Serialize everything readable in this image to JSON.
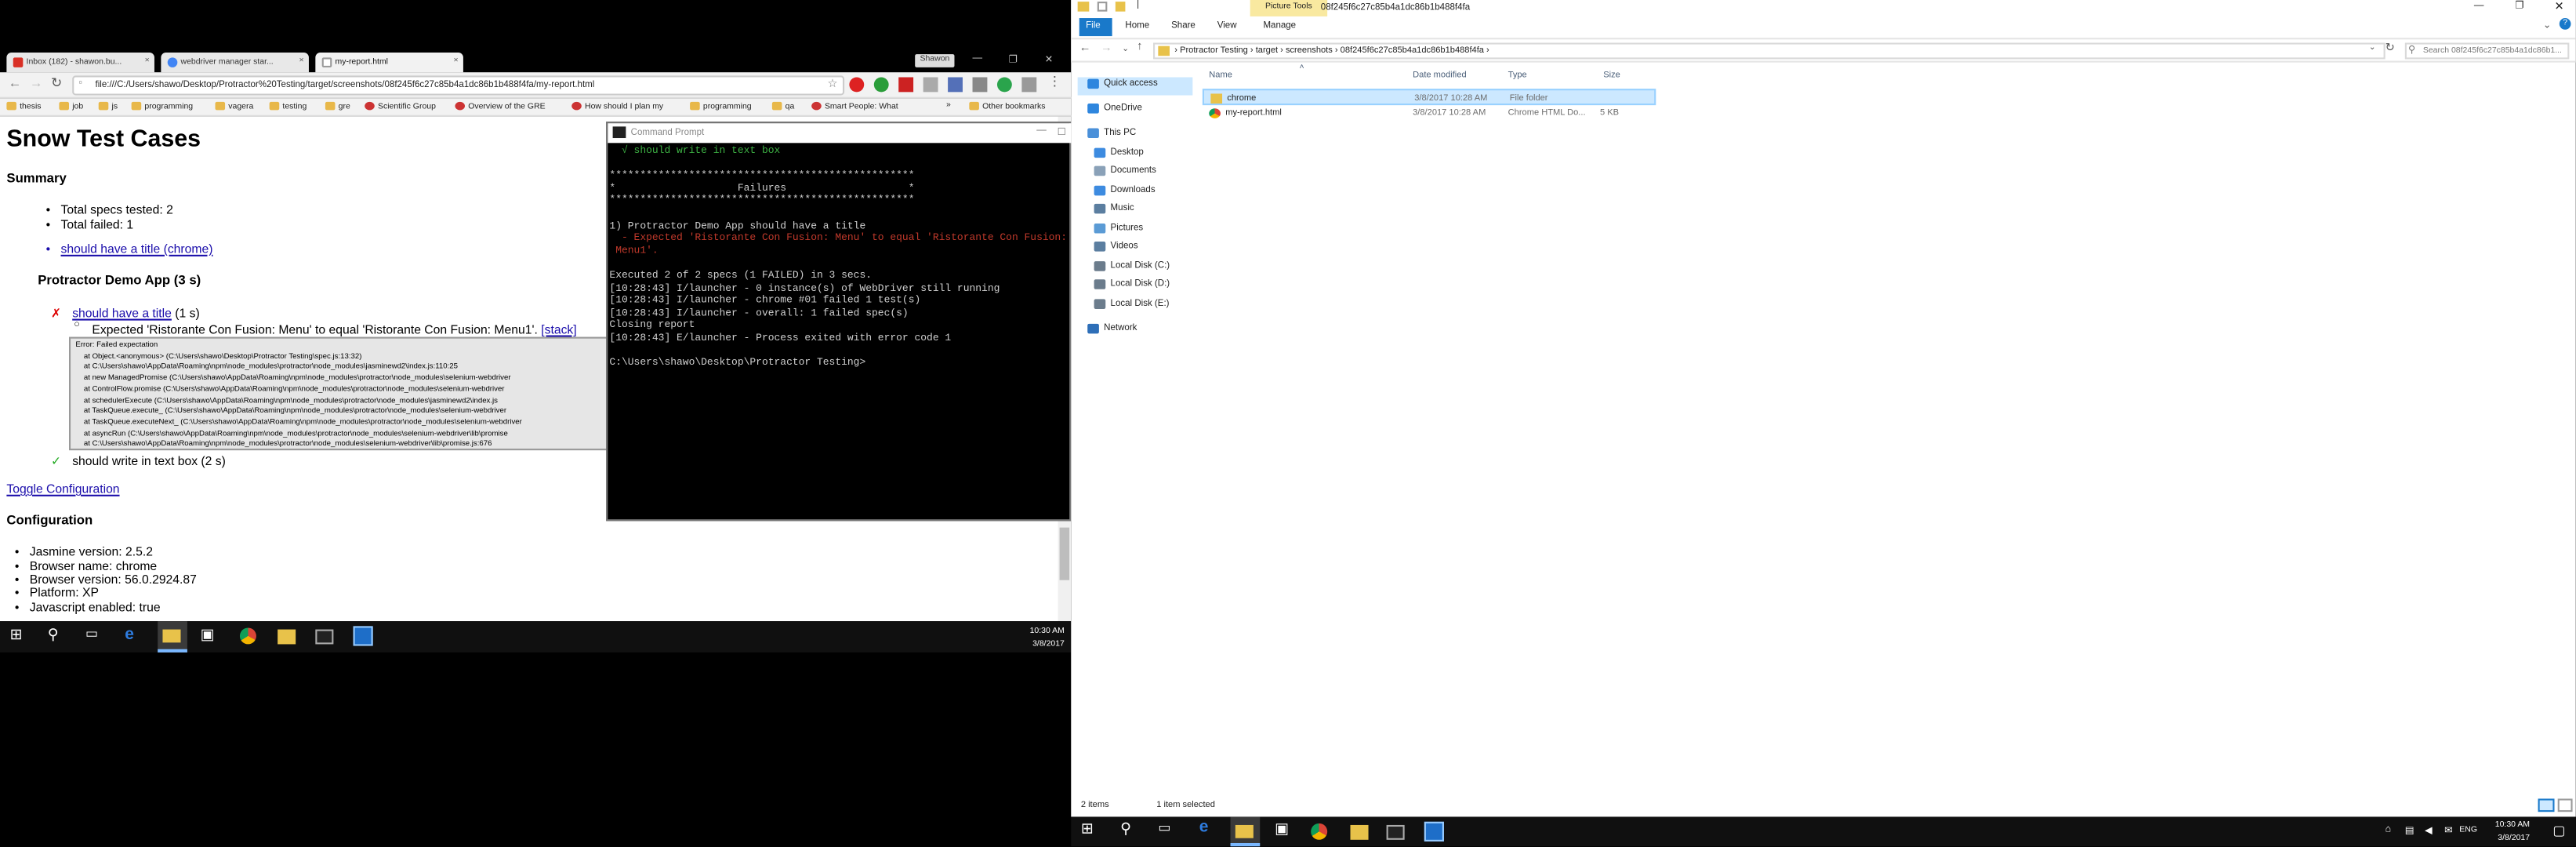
{
  "browser": {
    "tabs": [
      {
        "label": "Inbox (182) - shawon.bu..."
      },
      {
        "label": "webdriver manager star..."
      },
      {
        "label": "my-report.html"
      }
    ],
    "user_label": "Shawon",
    "url": "file:///C:/Users/shawo/Desktop/Protractor%20Testing/target/screenshots/08f245f6c27c85b4a1dc86b1b488f4fa/my-report.html",
    "bookmarks": [
      "thesis",
      "job",
      "js",
      "programming",
      "vagera",
      "testing",
      "gre",
      "Scientific Group",
      "Overview of the GRE",
      "How should I plan my",
      "programming",
      "qa",
      "Smart People: What",
      "Other bookmarks"
    ],
    "overflow": "»"
  },
  "report": {
    "title": "Snow Test Cases",
    "summary_heading": "Summary",
    "total_specs": "Total specs tested: 2",
    "total_failed": "Total failed: 1",
    "failed_link": "should have a title (chrome)",
    "suite": "Protractor Demo App (3 s)",
    "fail_mark": "✗",
    "spec1_link": "should have a title",
    "spec1_time": "(1 s)",
    "expectation": "Expected 'Ristorante Con Fusion: Menu' to equal 'Ristorante Con Fusion: Menu1'.",
    "stack_link": "[stack]",
    "stack": [
      "Error: Failed expectation",
      "at Object.<anonymous> (C:\\Users\\shawo\\Desktop\\Protractor Testing\\spec.js:13:32)",
      "at C:\\Users\\shawo\\AppData\\Roaming\\npm\\node_modules\\protractor\\node_modules\\jasminewd2\\index.js:110:25",
      "at new ManagedPromise (C:\\Users\\shawo\\AppData\\Roaming\\npm\\node_modules\\protractor\\node_modules\\selenium-webdriver",
      "at ControlFlow.promise (C:\\Users\\shawo\\AppData\\Roaming\\npm\\node_modules\\protractor\\node_modules\\selenium-webdriver",
      "at schedulerExecute (C:\\Users\\shawo\\AppData\\Roaming\\npm\\node_modules\\protractor\\node_modules\\jasminewd2\\index.js",
      "at TaskQueue.execute_ (C:\\Users\\shawo\\AppData\\Roaming\\npm\\node_modules\\protractor\\node_modules\\selenium-webdriver",
      "at TaskQueue.executeNext_ (C:\\Users\\shawo\\AppData\\Roaming\\npm\\node_modules\\protractor\\node_modules\\selenium-webdriver",
      "at asyncRun (C:\\Users\\shawo\\AppData\\Roaming\\npm\\node_modules\\protractor\\node_modules\\selenium-webdriver\\lib\\promise",
      "at C:\\Users\\shawo\\AppData\\Roaming\\npm\\node_modules\\protractor\\node_modules\\selenium-webdriver\\lib\\promise.js:676"
    ],
    "pass_mark": "✓",
    "spec2": "should write in text box (2 s)",
    "toggle": "Toggle Configuration",
    "config_heading": "Configuration",
    "config": [
      "Jasmine version: 2.5.2",
      "Browser name: chrome",
      "Browser version: 56.0.2924.87",
      "Platform: XP",
      "Javascript enabled: true"
    ]
  },
  "cmd": {
    "title": "Command Prompt",
    "lines": [
      {
        "t": "  √ should write in text box",
        "c": "g"
      },
      {
        "t": "",
        "c": ""
      },
      {
        "t": "**************************************************",
        "c": ""
      },
      {
        "t": "*                    Failures                    *",
        "c": ""
      },
      {
        "t": "**************************************************",
        "c": ""
      },
      {
        "t": "",
        "c": ""
      },
      {
        "t": "1) Protractor Demo App should have a title",
        "c": ""
      },
      {
        "t": "  - Expected 'Ristorante Con Fusion: Menu' to equal 'Ristorante Con Fusion:",
        "c": "r"
      },
      {
        "t": " Menu1'.",
        "c": "r"
      },
      {
        "t": "",
        "c": ""
      },
      {
        "t": "Executed 2 of 2 specs (1 FAILED) in 3 secs.",
        "c": ""
      },
      {
        "t": "[10:28:43] I/launcher - 0 instance(s) of WebDriver still running",
        "c": ""
      },
      {
        "t": "[10:28:43] I/launcher - chrome #01 failed 1 test(s)",
        "c": ""
      },
      {
        "t": "[10:28:43] I/launcher - overall: 1 failed spec(s)",
        "c": ""
      },
      {
        "t": "Closing report",
        "c": ""
      },
      {
        "t": "[10:28:43] E/launcher - Process exited with error code 1",
        "c": ""
      },
      {
        "t": "",
        "c": ""
      },
      {
        "t": "C:\\Users\\shawo\\Desktop\\Protractor Testing>",
        "c": ""
      }
    ]
  },
  "left_taskbar": {
    "time": "10:30 AM",
    "date": "3/8/2017"
  },
  "explorer": {
    "title": "08f245f6c27c85b4a1dc86b1b488f4fa",
    "picture_tools": "Picture Tools",
    "ribbon": [
      "Home",
      "Share",
      "View",
      "Manage"
    ],
    "file_tab": "File",
    "breadcrumb": "›  Protractor Testing  ›  target  ›  screenshots  ›  08f245f6c27c85b4a1dc86b1b488f4fa  ›",
    "search_placeholder": "Search 08f245f6c27c85b4a1dc86b1...",
    "nav": [
      {
        "label": "Quick access",
        "color": "#2e86de"
      },
      {
        "label": "OneDrive",
        "color": "#2e86de"
      },
      {
        "label": "This PC",
        "color": "#4a90d9"
      },
      {
        "label": "Desktop",
        "color": "#3d8be0"
      },
      {
        "label": "Documents",
        "color": "#8aa1b8"
      },
      {
        "label": "Downloads",
        "color": "#3d8be0"
      },
      {
        "label": "Music",
        "color": "#5b7ea0"
      },
      {
        "label": "Pictures",
        "color": "#5b9bd5"
      },
      {
        "label": "Videos",
        "color": "#5b7ea0"
      },
      {
        "label": "Local Disk (C:)",
        "color": "#6b7c8c"
      },
      {
        "label": "Local Disk (D:)",
        "color": "#6b7c8c"
      },
      {
        "label": "Local Disk (E:)",
        "color": "#6b7c8c"
      },
      {
        "label": "Network",
        "color": "#2e6fb8"
      }
    ],
    "columns": [
      "Name",
      "Date modified",
      "Type",
      "Size"
    ],
    "files": [
      {
        "name": "chrome",
        "date": "3/8/2017 10:28 AM",
        "type": "File folder",
        "size": "",
        "selected": true
      },
      {
        "name": "my-report.html",
        "date": "3/8/2017 10:28 AM",
        "type": "Chrome HTML Do...",
        "size": "5 KB",
        "selected": false
      }
    ],
    "status_items": "2 items",
    "status_selected": "1 item selected"
  },
  "right_taskbar": {
    "time": "10:30 AM",
    "date": "3/8/2017",
    "lang": "ENG"
  }
}
